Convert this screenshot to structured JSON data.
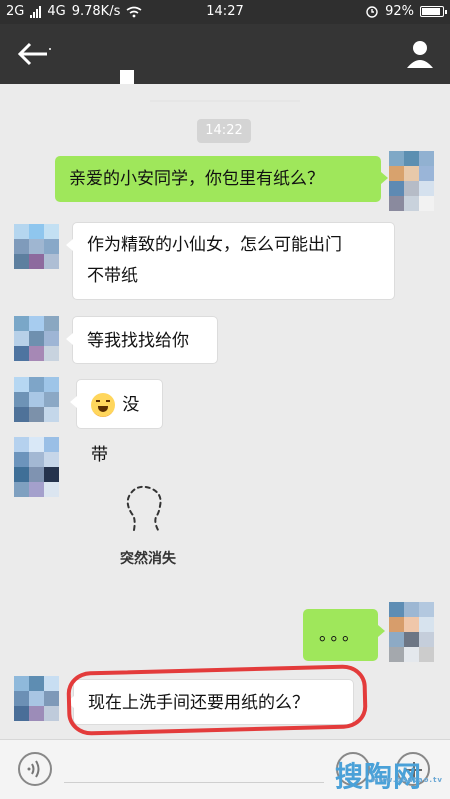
{
  "status_bar": {
    "network_left": "2G",
    "network_right": "4G",
    "speed": "9.78K/s",
    "time": "14:27",
    "battery": "92%",
    "battery_level": 0.92
  },
  "header": {
    "back_icon": "back-icon",
    "contact_icon": "user-icon"
  },
  "chat": {
    "timestamp": "14:22",
    "messages": [
      {
        "side": "right",
        "text": "亲爱的小安同学，你包里有纸么？"
      },
      {
        "side": "left",
        "text_line1": "作为精致的小仙女，怎么可能出门",
        "text_line2": "不带纸"
      },
      {
        "side": "left",
        "text": "等我找找给你"
      },
      {
        "side": "left",
        "text": "没带",
        "emoji": "laughing-cry-emoji"
      },
      {
        "side": "left",
        "sticker_caption": "突然消失"
      },
      {
        "side": "right",
        "text": "。。。"
      },
      {
        "side": "left",
        "text": "现在上洗手间还要用纸的么？"
      }
    ]
  },
  "bottom_bar": {
    "voice_icon": "voice-icon",
    "emoji_icon": "emoji-icon",
    "plus_icon": "plus-icon"
  },
  "watermark": {
    "text": "搜陶网",
    "url": "www.soutao.tv"
  }
}
